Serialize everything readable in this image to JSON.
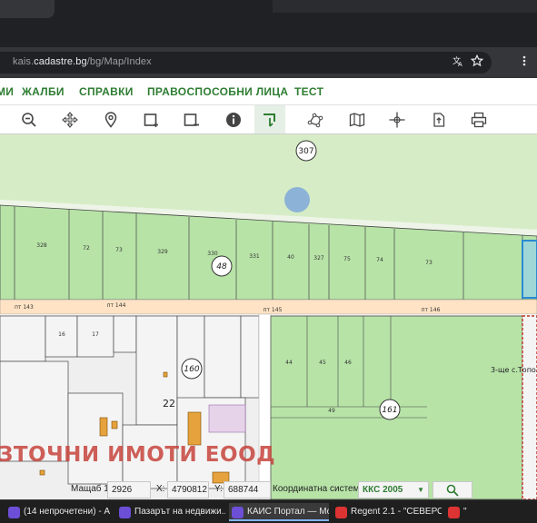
{
  "browser": {
    "url_prefix": "kais.",
    "url_domain": "cadastre.bg",
    "url_path": "/bg/Map/Index",
    "translate_icon": "translate-icon",
    "bookmark_icon": "star-icon",
    "menu_icon": "more-vert-icon"
  },
  "menu": {
    "items": [
      {
        "label": "МИ"
      },
      {
        "label": "ЖАЛБИ"
      },
      {
        "label": "СПРАВКИ"
      },
      {
        "label": "ПРАВОСПОСОБНИ ЛИЦА"
      },
      {
        "label": "ТЕСТ"
      }
    ]
  },
  "toolbar": {
    "tools": [
      "zoom-out-icon",
      "pan-icon",
      "location-pin-icon",
      "add-rectangle-icon",
      "remove-rectangle-icon",
      "info-icon",
      "select-parcel-icon",
      "draw-polygon-icon",
      "map-layers-icon",
      "crosshair-icon",
      "export-icon",
      "print-icon"
    ]
  },
  "map": {
    "labels": {
      "circle_307": "307",
      "circle_48": "48",
      "circle_160": "160",
      "circle_161": "161",
      "road_143": "пт 143",
      "road_144": "пт 144",
      "road_145": "пт 145",
      "road_146": "пт 146",
      "parcel_22": "22",
      "place_name": "3-ще с.Топол",
      "company_watermark": "ЗТОЧНИ ИМОТИ ЕООД",
      "p_328": "328",
      "p_72": "72",
      "p_73a": "73",
      "p_329": "329",
      "p_330": "330",
      "p_331": "331",
      "p_40": "40",
      "p_327": "327",
      "p_75": "75",
      "p_74": "74",
      "p_73b": "73",
      "p_16": "16",
      "p_17": "17",
      "p_44": "44",
      "p_45": "45",
      "p_49": "49",
      "p_46": "46"
    }
  },
  "status": {
    "scale_label": "Мащаб 1:",
    "scale_value": "2926",
    "x_label": "X:",
    "x_value": "4790812",
    "y_label": "Y:",
    "y_value": "688744",
    "coord_label": "Координатна система:",
    "coord_value": "ККС 2005"
  },
  "taskbar": {
    "items": [
      {
        "label": "(14 непрочетени) - А..."
      },
      {
        "label": "Пазарът на недвижи..."
      },
      {
        "label": "КАИС Портал — Мо..."
      },
      {
        "label": "Regent 2.1 - \"СЕВЕРО..."
      },
      {
        "label": "\""
      }
    ]
  }
}
